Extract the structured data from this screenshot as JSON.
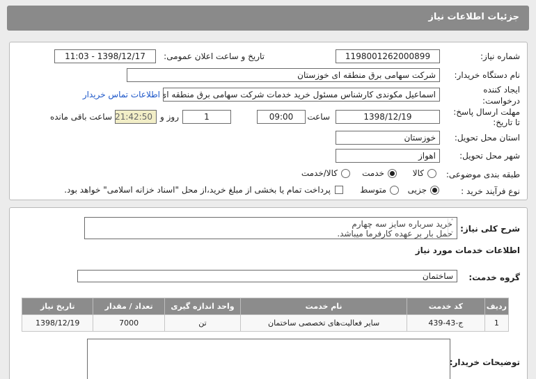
{
  "header": {
    "title": "جزئیات اطلاعات نیاز"
  },
  "info": {
    "need_number_label": "شماره نیاز:",
    "need_number": "1198001262000899",
    "announce_label": "تاریخ و ساعت اعلان عمومی:",
    "announce_value": "1398/12/17 - 11:03",
    "buyer_org_label": "نام دستگاه خریدار:",
    "buyer_org": "شرکت سهامی برق منطقه ای خوزستان",
    "creator_label_1": "ایجاد کننده",
    "creator_label_2": "درخواست:",
    "creator": "اسماعیل مکوندی کارشناس مسئول خرید خدمات شرکت سهامی برق منطقه ای",
    "contact_link": "اطلاعات تماس خریدار",
    "deadline_label_1": "مهلت ارسال پاسخ:",
    "deadline_label_2": "تا تاریخ:",
    "deadline_date": "1398/12/19",
    "time_label": "ساعت",
    "deadline_time": "09:00",
    "days_value": "1",
    "days_label": "روز و",
    "remaining_time": "21:42:50",
    "remaining_label": "ساعت باقی مانده",
    "province_label": "استان محل تحویل:",
    "province": "خوزستان",
    "city_label": "شهر محل تحویل:",
    "city": "اهواز",
    "category_label": "طبقه بندی موضوعی:",
    "category_options": [
      "کالا",
      "خدمت",
      "کالا/خدمت"
    ],
    "category_selected": "خدمت",
    "process_label": "نوع فرآیند خرید :",
    "process_options": [
      "جزیی",
      "متوسط"
    ],
    "process_selected": "جزیی",
    "payment_note": "پرداخت تمام یا بخشی از مبلغ خرید،از محل \"اسناد خزانه اسلامی\" خواهد بود."
  },
  "details": {
    "summary_label": "شرح کلی نیاز:",
    "summary_line1": "خرید سرباره سایز سه چهارم",
    "summary_line2": "حمل بار بر عهده کارفرما میباشد.",
    "services_heading": "اطلاعات خدمات مورد نیاز",
    "service_group_label": "گروه خدمت:",
    "service_group": "ساختمان",
    "table_headers": [
      "ردیف",
      "کد خدمت",
      "نام خدمت",
      "واحد اندازه گیری",
      "تعداد / مقدار",
      "تاریخ نیاز"
    ],
    "rows": [
      [
        "1",
        "ج-43-439",
        "سایر فعالیت‌های تخصصی ساختمان",
        "تن",
        "7000",
        "1398/12/19"
      ]
    ],
    "buyer_notes_label": "توضیحات خریدار:"
  }
}
